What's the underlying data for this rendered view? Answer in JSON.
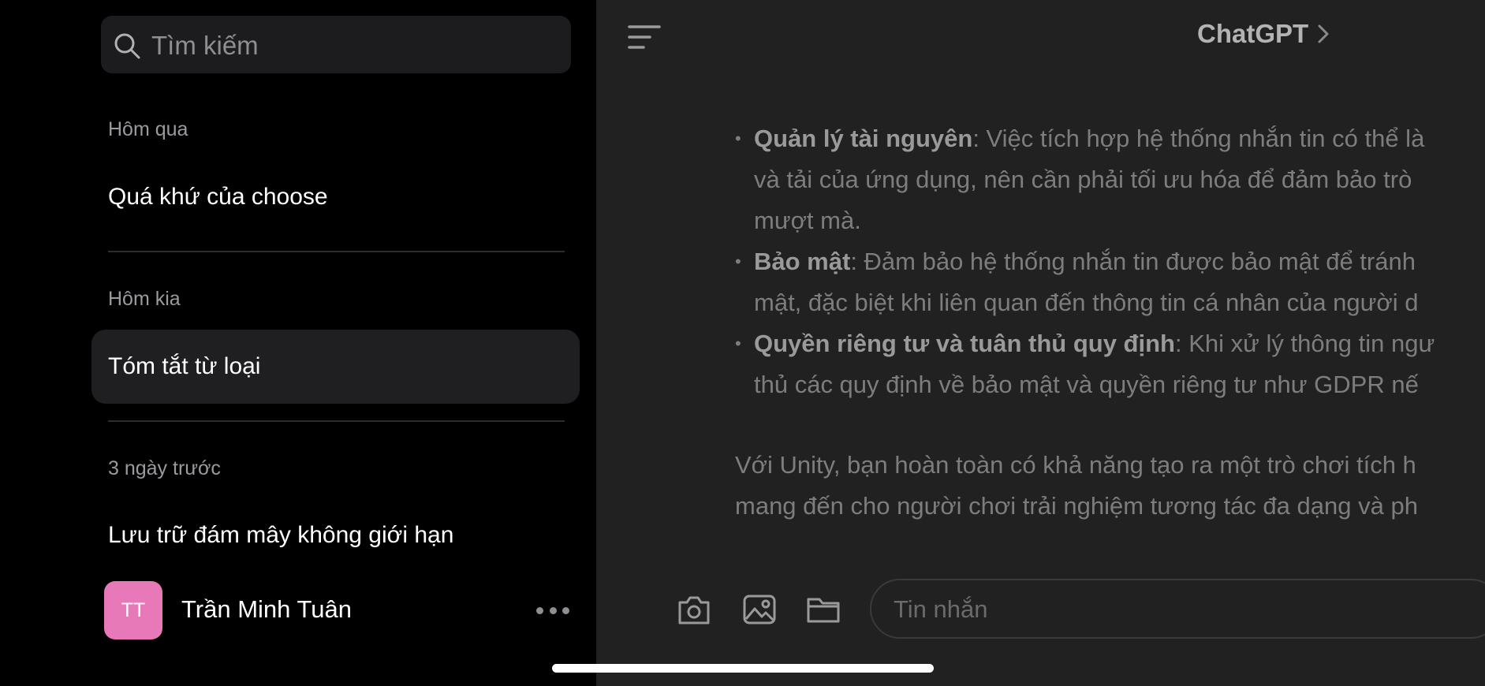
{
  "sidebar": {
    "search": {
      "placeholder": "Tìm kiếm"
    },
    "sections": [
      {
        "label": "Hôm qua",
        "items": [
          "Quá khứ của choose"
        ]
      },
      {
        "label": "Hôm kia",
        "items": [
          "Tóm tắt từ loại"
        ]
      },
      {
        "label": "3 ngày trước",
        "items": [
          "Lưu trữ đám mây không giới hạn"
        ]
      }
    ],
    "user": {
      "initials": "TT",
      "name": "Trần Minh Tuân"
    }
  },
  "main": {
    "title": "ChatGPT",
    "bullets": [
      {
        "bold": "Quản lý tài nguyên",
        "lines": [
          ": Việc tích hợp hệ thống nhắn tin có thể là",
          "và tải của ứng dụng, nên cần phải tối ưu hóa để đảm bảo trò",
          "mượt mà."
        ]
      },
      {
        "bold": "Bảo mật",
        "lines": [
          ": Đảm bảo hệ thống nhắn tin được bảo mật để tránh",
          "mật, đặc biệt khi liên quan đến thông tin cá nhân của người d"
        ]
      },
      {
        "bold": "Quyền riêng tư và tuân thủ quy định",
        "lines": [
          ": Khi xử lý thông tin ngư",
          "thủ các quy định về bảo mật và quyền riêng tư như GDPR nế"
        ]
      }
    ],
    "paragraph": [
      "Với Unity, bạn hoàn toàn có khả năng tạo ra một trò chơi tích h",
      "mang đến cho người chơi trải nghiệm tương tác đa dạng và ph"
    ],
    "composer": {
      "placeholder": "Tin nhắn"
    }
  },
  "icons": {
    "search": "search-icon",
    "menu": "menu-icon",
    "chevron": "chevron-right-icon",
    "camera": "camera-icon",
    "photo": "photo-icon",
    "folder": "folder-icon",
    "more": "more-icon"
  },
  "colors": {
    "sidebar_bg": "#000000",
    "main_bg": "#212121",
    "avatar_bg": "#e879b9",
    "active_item_bg": "#1f1f21"
  }
}
